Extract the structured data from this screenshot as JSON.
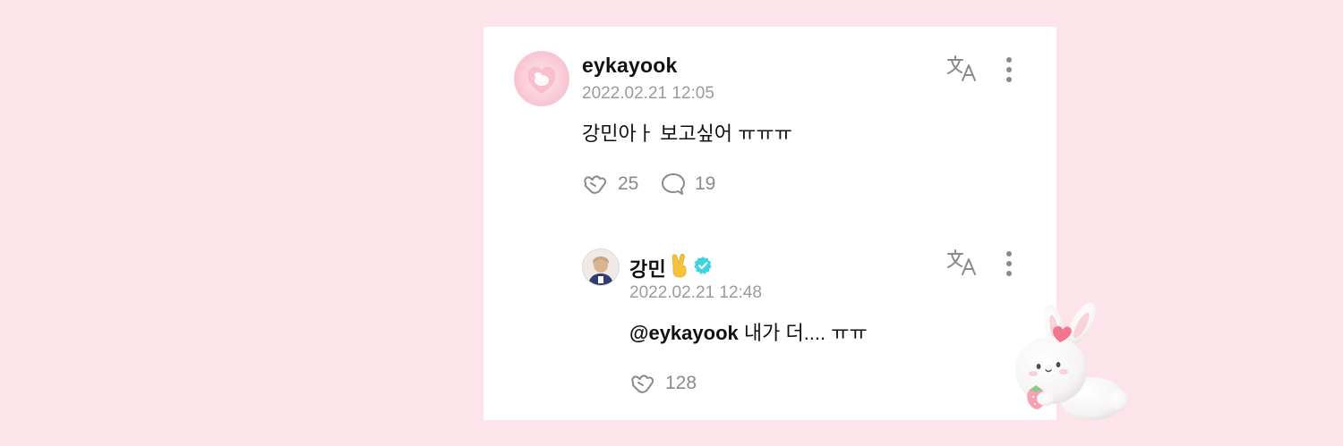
{
  "comment": {
    "username": "eykayook",
    "timestamp": "2022.02.21 12:05",
    "text": "강민아ㅏ 보고싶어 ㅠㅠㅠ",
    "likes": "25",
    "replies": "19"
  },
  "reply": {
    "username": "강민",
    "username_emoji": "✌️",
    "verified": true,
    "timestamp": "2022.02.21 12:48",
    "mention": "@eykayook",
    "text": " 내가 더.... ㅠㅠ",
    "likes": "128"
  },
  "colors": {
    "background": "#fde3ea",
    "card": "#ffffff",
    "verified_badge": "#3fd3e0",
    "muted_text": "#9b9b9b"
  },
  "icons": {
    "like": "heart-hands-icon",
    "reply": "speech-bubble-icon",
    "translate": "translate-icon",
    "more": "kebab-menu-icon"
  }
}
